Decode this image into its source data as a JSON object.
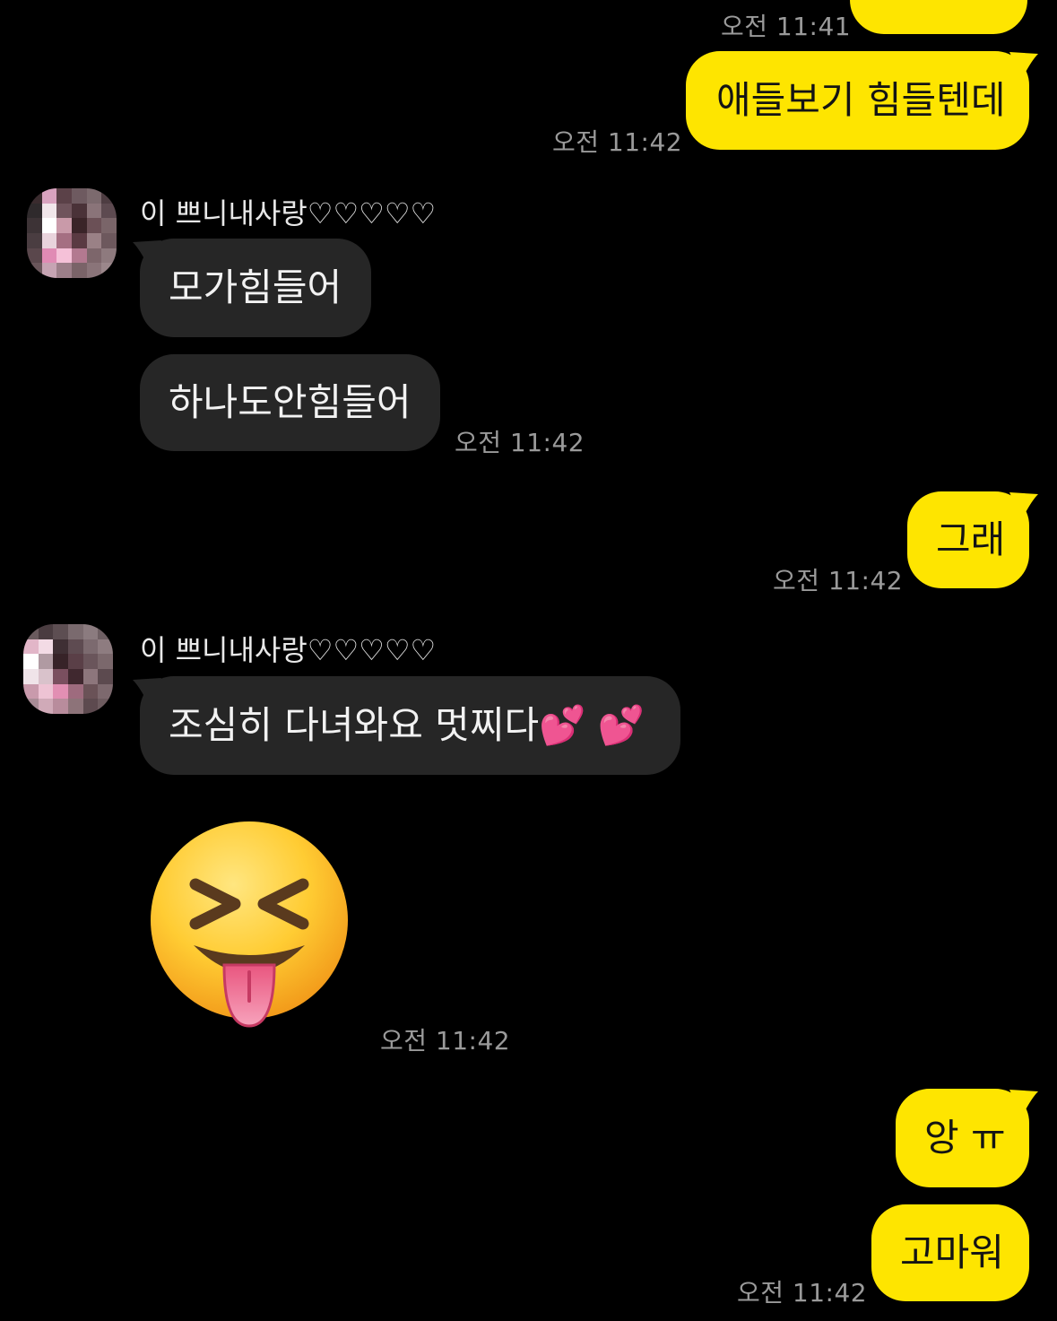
{
  "chat": {
    "partner_name": "이 쁘니내사랑♡♡♡♡♡",
    "messages": [
      {
        "id": "m0",
        "sender": "me",
        "text": "",
        "time": "오전 11:41"
      },
      {
        "id": "m1",
        "sender": "me",
        "text": "애들보기 힘들텐데",
        "time": "오전 11:42"
      },
      {
        "id": "m2",
        "sender": "partner",
        "text": "모가힘들어",
        "time": ""
      },
      {
        "id": "m3",
        "sender": "partner",
        "text": "하나도안힘들어",
        "time": "오전 11:42"
      },
      {
        "id": "m4",
        "sender": "me",
        "text": "그래",
        "time": "오전 11:42"
      },
      {
        "id": "m5",
        "sender": "partner",
        "text": "조심히 다녀와요 멋찌다💕 💕",
        "time": ""
      },
      {
        "id": "m6",
        "sender": "partner",
        "emoji": "squinting-face-with-tongue-emoji",
        "time": "오전 11:42"
      },
      {
        "id": "m7",
        "sender": "me",
        "text": "앙 ㅠ",
        "time": ""
      },
      {
        "id": "m8",
        "sender": "me",
        "text": "고마워",
        "time": "오전 11:42"
      }
    ]
  },
  "colors": {
    "background": "#000000",
    "my_bubble": "#FEE500",
    "partner_bubble": "#262626",
    "timestamp": "#9A9A9A"
  }
}
